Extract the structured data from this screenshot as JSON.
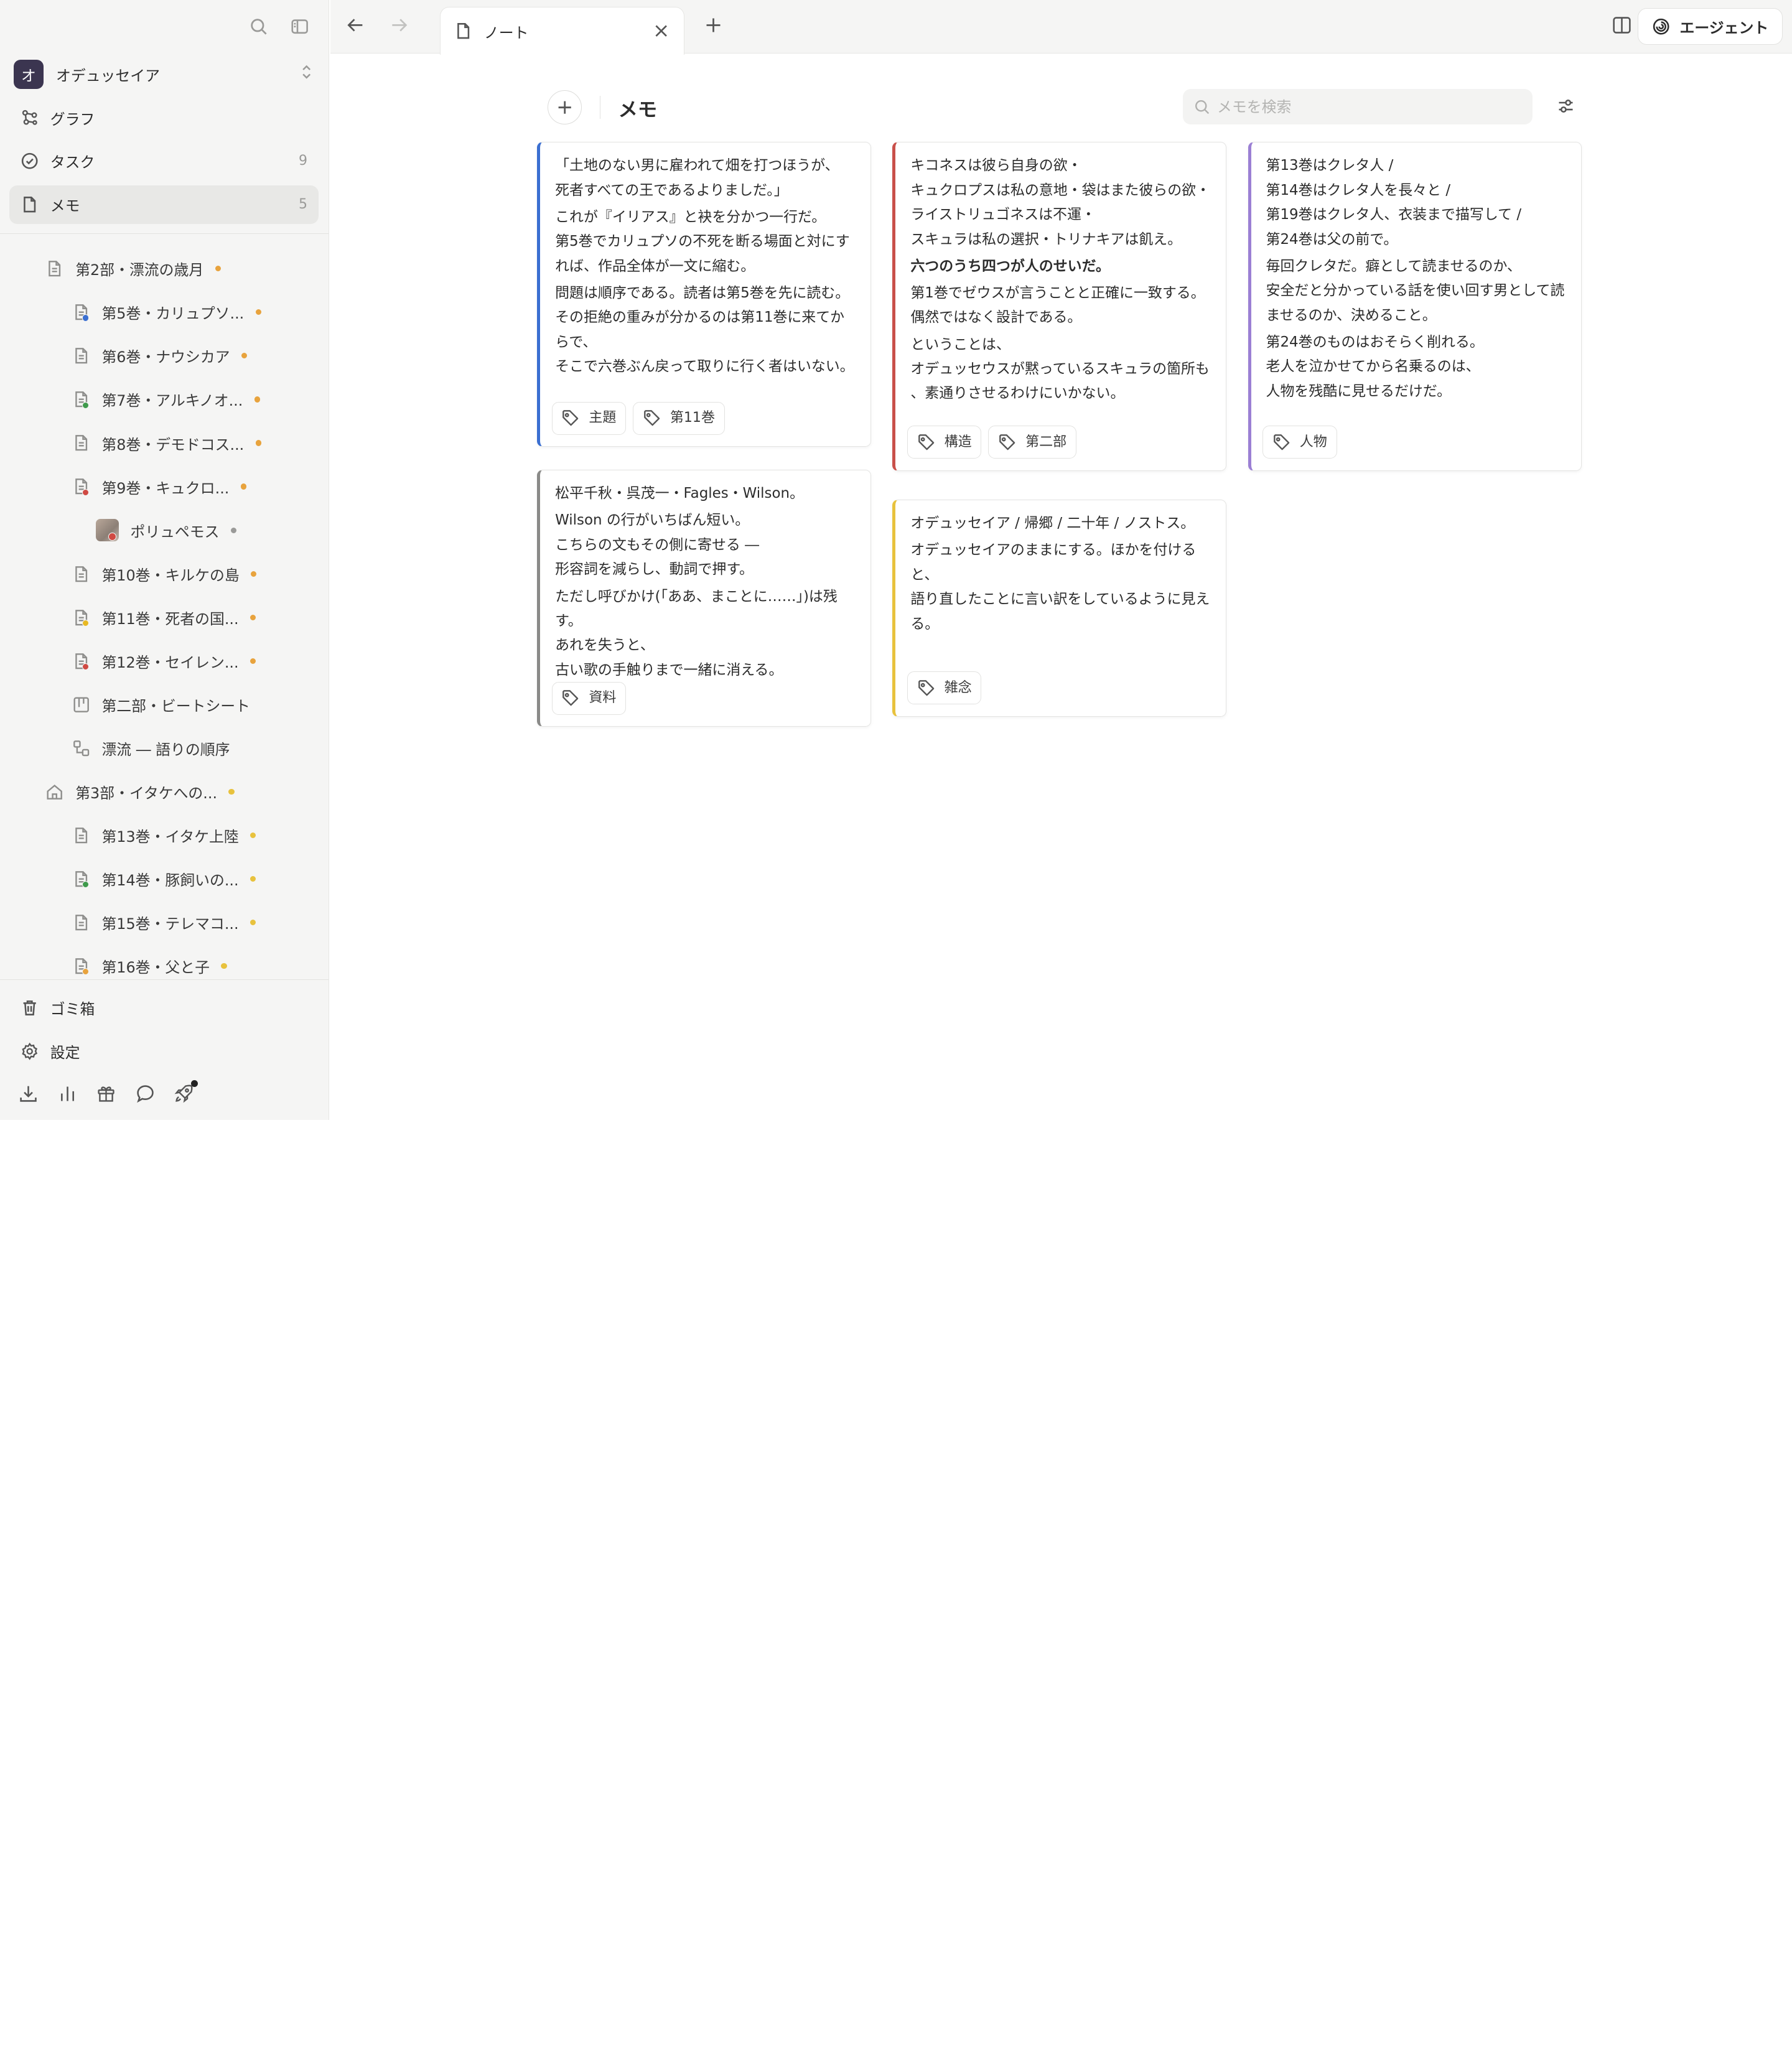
{
  "sidebar": {
    "workspace": {
      "initial": "オ",
      "name": "オデュッセイア"
    },
    "nav": [
      {
        "label": "グラフ",
        "icon": "graph-icon",
        "count": ""
      },
      {
        "label": "タスク",
        "icon": "task-check-icon",
        "count": "9"
      },
      {
        "label": "メモ",
        "icon": "memo-icon",
        "count": "5",
        "active": true
      }
    ],
    "tree": [
      {
        "label": "第2部・漂流の歳月",
        "indent": 1,
        "icon": "document-icon",
        "dot": "#e8a33d"
      },
      {
        "label": "第5巻・カリュプソ...",
        "indent": 2,
        "icon": "document-icon",
        "status": "#3b6fd1",
        "dot": "#e8a33d"
      },
      {
        "label": "第6巻・ナウシカア",
        "indent": 2,
        "icon": "document-icon",
        "dot": "#e8a33d"
      },
      {
        "label": "第7巻・アルキノオ...",
        "indent": 2,
        "icon": "document-icon",
        "status": "#3f9a4c",
        "dot": "#e8a33d"
      },
      {
        "label": "第8巻・デモドコス...",
        "indent": 2,
        "icon": "document-icon",
        "dot": "#e8a33d"
      },
      {
        "label": "第9巻・キュクロ...",
        "indent": 2,
        "icon": "document-icon",
        "status": "#d04a43",
        "dot": "#e8a33d"
      },
      {
        "label": "ポリュペモス",
        "indent": 3,
        "icon": "character-image-icon",
        "status": "#d04a43",
        "dot": "#9a9a98"
      },
      {
        "label": "第10巻・キルケの島",
        "indent": 2,
        "icon": "document-icon",
        "dot": "#e8a33d"
      },
      {
        "label": "第11巻・死者の国...",
        "indent": 2,
        "icon": "document-icon",
        "status": "#e8b923",
        "dot": "#e8a33d"
      },
      {
        "label": "第12巻・セイレン...",
        "indent": 2,
        "icon": "document-icon",
        "status": "#d04a43",
        "dot": "#e8a33d"
      },
      {
        "label": "第二部・ビートシート",
        "indent": 2,
        "icon": "beat-sheet-icon",
        "dot": ""
      },
      {
        "label": "漂流 ― 語りの順序",
        "indent": 2,
        "icon": "sequence-icon",
        "dot": ""
      },
      {
        "label": "第3部・イタケへの...",
        "indent": 1,
        "icon": "home-icon",
        "dot": "#e8c23d"
      },
      {
        "label": "第13巻・イタケ上陸",
        "indent": 2,
        "icon": "document-icon",
        "dot": "#e8c23d"
      },
      {
        "label": "第14巻・豚飼いの...",
        "indent": 2,
        "icon": "document-icon",
        "status": "#3f9a4c",
        "dot": "#e8c23d"
      },
      {
        "label": "第15巻・テレマコ...",
        "indent": 2,
        "icon": "document-icon",
        "dot": "#e8c23d"
      },
      {
        "label": "第16巻・父と子",
        "indent": 2,
        "icon": "document-icon",
        "status": "#e8a33d",
        "dot": "#e8c23d"
      }
    ],
    "bottom": [
      {
        "label": "ゴミ箱",
        "icon": "trash-icon"
      },
      {
        "label": "設定",
        "icon": "settings-gear-icon"
      }
    ]
  },
  "topbar": {
    "tab_label": "ノート",
    "agent_label": "エージェント"
  },
  "main": {
    "title": "メモ",
    "search_placeholder": "メモを検索",
    "cards": [
      {
        "accent": "#3b6fd1",
        "lines": [
          {
            "text": "「土地のない男に雇われて畑を打つほうが、\n死者すべての王であるよりましだ。」",
            "bold": false
          },
          {
            "text": "これが『イリアス』と袂を分かつ一行だ。\n第5巻でカリュプソの不死を断る場面と対にすれば、作品全体が一文に縮む。",
            "bold": false
          },
          {
            "text": "問題は順序である。読者は第5巻を先に読む。\nその拒絶の重みが分かるのは第11巻に来てからで、\nそこで六巻ぶん戻って取りに行く者はいない。",
            "bold": false
          }
        ],
        "tags": [
          "主題",
          "第11巻"
        ]
      },
      {
        "accent": "#8a8a88",
        "lines": [
          {
            "text": "松平千秋・呉茂一・Fagles・Wilson。",
            "bold": false
          },
          {
            "text": "Wilson の行がいちばん短い。\nこちらの文もその側に寄せる ―\n形容詞を減らし、動詞で押す。",
            "bold": false
          },
          {
            "text": "ただし呼びかけ(「ああ、まことに……」)は残す。\nあれを失うと、\n古い歌の手触りまで一緒に消える。",
            "bold": false
          }
        ],
        "tags": [
          "資料"
        ]
      },
      {
        "accent": "#c9504a",
        "lines": [
          {
            "text": "キコネスは彼ら自身の欲・\nキュクロプスは私の意地・袋はまた彼らの欲・\nライストリュゴネスは不運・\nスキュラは私の選択・トリナキアは飢え。",
            "bold": false
          },
          {
            "text": "六つのうち四つが人のせいだ。",
            "bold": true
          },
          {
            "text": "第1巻でゼウスが言うことと正確に一致する。\n偶然ではなく設計である。",
            "bold": false
          },
          {
            "text": "ということは、\nオデュッセウスが黙っているスキュラの箇所も\n、素通りさせるわけにいかない。",
            "bold": false
          }
        ],
        "tags": [
          "構造",
          "第二部"
        ]
      },
      {
        "accent": "#e8c23d",
        "lines": [
          {
            "text": "オデュッセイア / 帰郷 / 二十年 / ノストス。",
            "bold": false
          },
          {
            "text": "オデュッセイアのままにする。ほかを付けると、\n語り直したことに言い訳をしているように見える。",
            "bold": false
          }
        ],
        "tags": [
          "雑念"
        ]
      },
      {
        "accent": "#9b7fd4",
        "lines": [
          {
            "text": "第13巻はクレタ人 /\n第14巻はクレタ人を長々と /\n第19巻はクレタ人、衣装まで描写して /\n第24巻は父の前で。",
            "bold": false
          },
          {
            "text": "毎回クレタだ。癖として読ませるのか、\n安全だと分かっている話を使い回す男として読ませるのか、決めること。",
            "bold": false
          },
          {
            "text": "第24巻のものはおそらく削れる。\n老人を泣かせてから名乗るのは、\n人物を残酷に見せるだけだ。",
            "bold": false
          }
        ],
        "tags": [
          "人物"
        ]
      }
    ]
  }
}
